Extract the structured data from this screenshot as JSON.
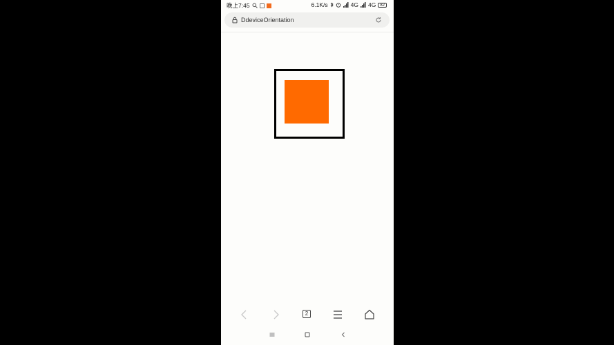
{
  "status_bar": {
    "time": "晚上7:45",
    "network_speed": "6.1K/s",
    "signal1": "4G",
    "signal2": "4G",
    "battery": "82"
  },
  "address_bar": {
    "url": "DdeviceOrientation",
    "lock_icon": "lock-icon",
    "reload_icon": "reload-icon"
  },
  "content": {
    "outer_border_color": "#000000",
    "inner_square_color": "#ff6a00"
  },
  "toolbar": {
    "tab_count": "2",
    "icons": [
      "back-icon",
      "forward-icon",
      "tabs-icon",
      "menu-icon",
      "home-icon"
    ]
  },
  "system_nav": {
    "icons": [
      "recents-icon",
      "home-square-icon",
      "back-triangle-icon"
    ]
  }
}
